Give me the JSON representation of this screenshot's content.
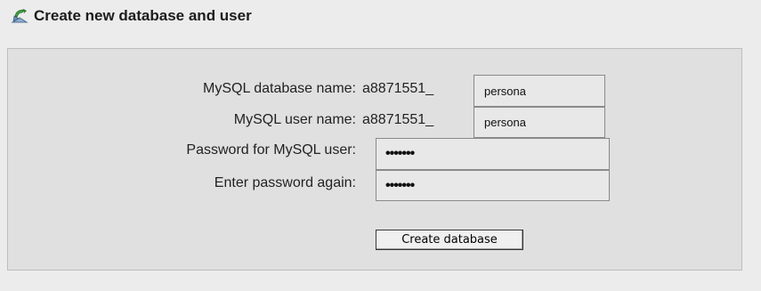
{
  "header": {
    "title": "Create new database and user",
    "icon": "database-user-icon"
  },
  "form": {
    "db_name": {
      "label": "MySQL database name:",
      "prefix": "a8871551_",
      "value": "persona"
    },
    "user_name": {
      "label": "MySQL user name:",
      "prefix": "a8871551_",
      "value": "persona"
    },
    "password": {
      "label": "Password for MySQL user:",
      "value": "•••••••"
    },
    "password_again": {
      "label": "Enter password again:",
      "value": "•••••••"
    },
    "submit_label": "Create database"
  }
}
